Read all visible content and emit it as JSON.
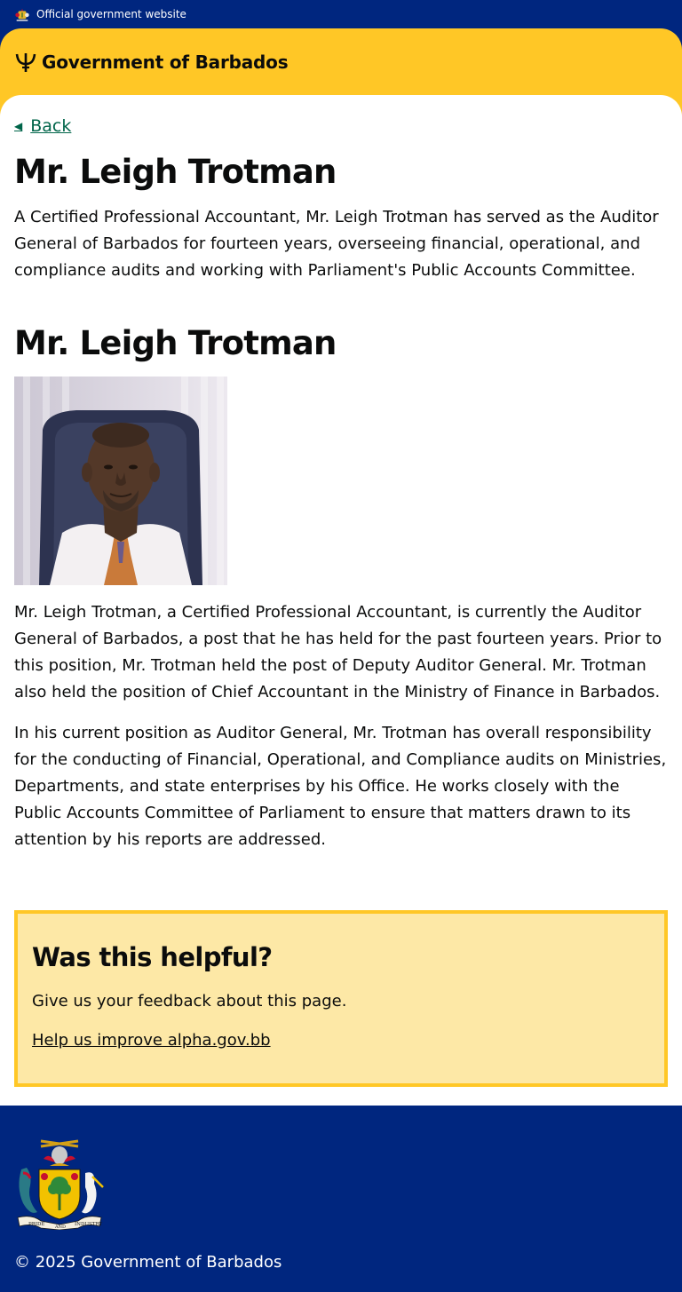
{
  "banner": {
    "text": "Official government website"
  },
  "header": {
    "site_name": "Government of Barbados"
  },
  "nav": {
    "back_label": "Back"
  },
  "page": {
    "title": "Mr. Leigh Trotman",
    "lead": "A Certified Professional Accountant, Mr. Leigh Trotman has served as the Auditor General of Barbados for fourteen years, overseeing financial, operational, and compliance audits and working with Parliament's Public Accounts Committee.",
    "section_title": "Mr. Leigh Trotman",
    "paragraphs": [
      "Mr. Leigh Trotman, a Certified Professional Accountant, is currently the Auditor General of Barbados, a post that he has held for the past fourteen years. Prior to this position, Mr. Trotman held the post of Deputy Auditor General. Mr. Trotman also held the position of Chief Accountant in the Ministry of Finance in Barbados.",
      "In his current position as Auditor General, Mr. Trotman has overall responsibility for the conducting of Financial, Operational, and Compliance audits on Ministries, Departments, and state enterprises by his Office. He works closely with the Public Accounts Committee of Parliament to ensure that matters drawn to its attention by his reports are addressed."
    ]
  },
  "feedback": {
    "title": "Was this helpful?",
    "text": "Give us your feedback about this page.",
    "link": "Help us improve alpha.gov.bb"
  },
  "footer": {
    "coat_motto_left": "PRIDE",
    "coat_motto_mid": "AND",
    "coat_motto_right": "INDUSTRY",
    "copyright": "© 2025 Government of Barbados"
  },
  "colors": {
    "navy": "#00267f",
    "gold": "#ffc726",
    "feedback_bg": "#fde8a6",
    "link_green": "#00654a"
  },
  "icons": {
    "banner": "coat-of-arms-icon",
    "brand": "trident-icon",
    "back": "arrow-left-icon",
    "footer": "coat-of-arms-icon"
  }
}
